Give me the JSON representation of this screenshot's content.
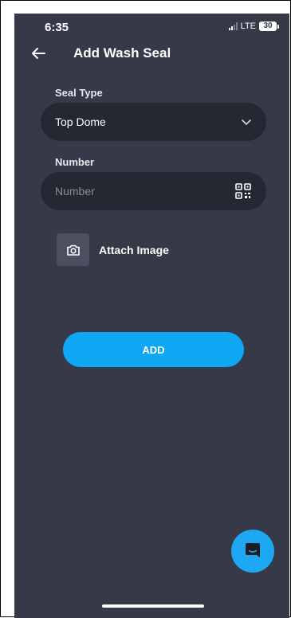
{
  "status_bar": {
    "time": "6:35",
    "network": "LTE",
    "battery": "30"
  },
  "header": {
    "back_icon": "arrow-left-icon",
    "title": "Add Wash Seal"
  },
  "form": {
    "seal_type": {
      "label": "Seal Type",
      "value": "Top Dome",
      "icon": "chevron-down-icon"
    },
    "number": {
      "label": "Number",
      "value": "",
      "placeholder": "Number",
      "icon": "qr-code-icon"
    },
    "attach": {
      "label": "Attach Image",
      "icon": "camera-icon"
    },
    "add_label": "ADD"
  },
  "fab": {
    "icon": "chat-icon"
  },
  "colors": {
    "background": "#363947",
    "field": "#252732",
    "accent": "#10a8f5"
  }
}
